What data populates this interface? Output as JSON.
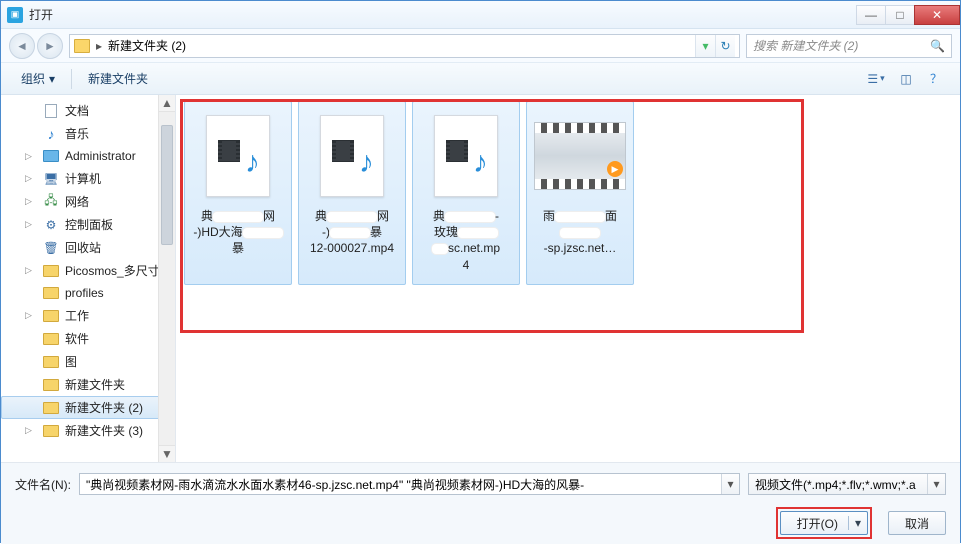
{
  "window": {
    "title": "打开"
  },
  "nav": {
    "path_segment": "新建文件夹 (2)",
    "search_placeholder": "搜索 新建文件夹 (2)"
  },
  "toolbar": {
    "organize": "组织",
    "new_folder": "新建文件夹"
  },
  "tree": {
    "items": [
      {
        "icon": "doc",
        "label": "文档"
      },
      {
        "icon": "music",
        "label": "音乐"
      },
      {
        "icon": "folder-blue",
        "label": "Administrator",
        "expandable": true
      },
      {
        "icon": "comp",
        "label": "计算机",
        "expandable": true
      },
      {
        "icon": "net",
        "label": "网络",
        "expandable": true
      },
      {
        "icon": "panel",
        "label": "控制面板",
        "expandable": true
      },
      {
        "icon": "bin",
        "label": "回收站"
      },
      {
        "icon": "folder",
        "label": "Picosmos_多尺寸",
        "expandable": true
      },
      {
        "icon": "folder",
        "label": "profiles"
      },
      {
        "icon": "folder",
        "label": "工作",
        "expandable": true
      },
      {
        "icon": "folder",
        "label": "软件"
      },
      {
        "icon": "folder",
        "label": "图"
      },
      {
        "icon": "folder",
        "label": "新建文件夹"
      },
      {
        "icon": "folder",
        "label": "新建文件夹 (2)",
        "selected": true
      },
      {
        "icon": "folder",
        "label": "新建文件夹 (3)",
        "expandable": true
      }
    ]
  },
  "files": [
    {
      "kind": "media",
      "selected": true,
      "line1": "典",
      "line1_tail": "网",
      "line2": "-)HD大海",
      "line2_tail": "暴",
      "line3": ""
    },
    {
      "kind": "media",
      "selected": true,
      "line1": "典",
      "line1_tail": "网",
      "line2": "-)",
      "line2_tail": "暴",
      "line3": "12-000027.mp4"
    },
    {
      "kind": "media",
      "selected": true,
      "line1": "典",
      "line1_tail": "-",
      "line2": "玫瑰",
      "line2_tail": "",
      "line3_a": "",
      "line3_b": "sc.net.mp",
      "line4": "4"
    },
    {
      "kind": "video",
      "selected": true,
      "line1": "雨",
      "line1_tail": "面",
      "line2": "",
      "line2_tail": "",
      "line3": "-sp.jzsc.net…"
    }
  ],
  "bottom": {
    "filename_label": "文件名(N):",
    "filename_value": "\"典尚视频素材网-雨水滴流水水面水素材46-sp.jzsc.net.mp4\" \"典尚视频素材网-)HD大海的风暴-",
    "filter_value": "视频文件(*.mp4;*.flv;*.wmv;*.a",
    "open": "打开(O)",
    "cancel": "取消"
  }
}
